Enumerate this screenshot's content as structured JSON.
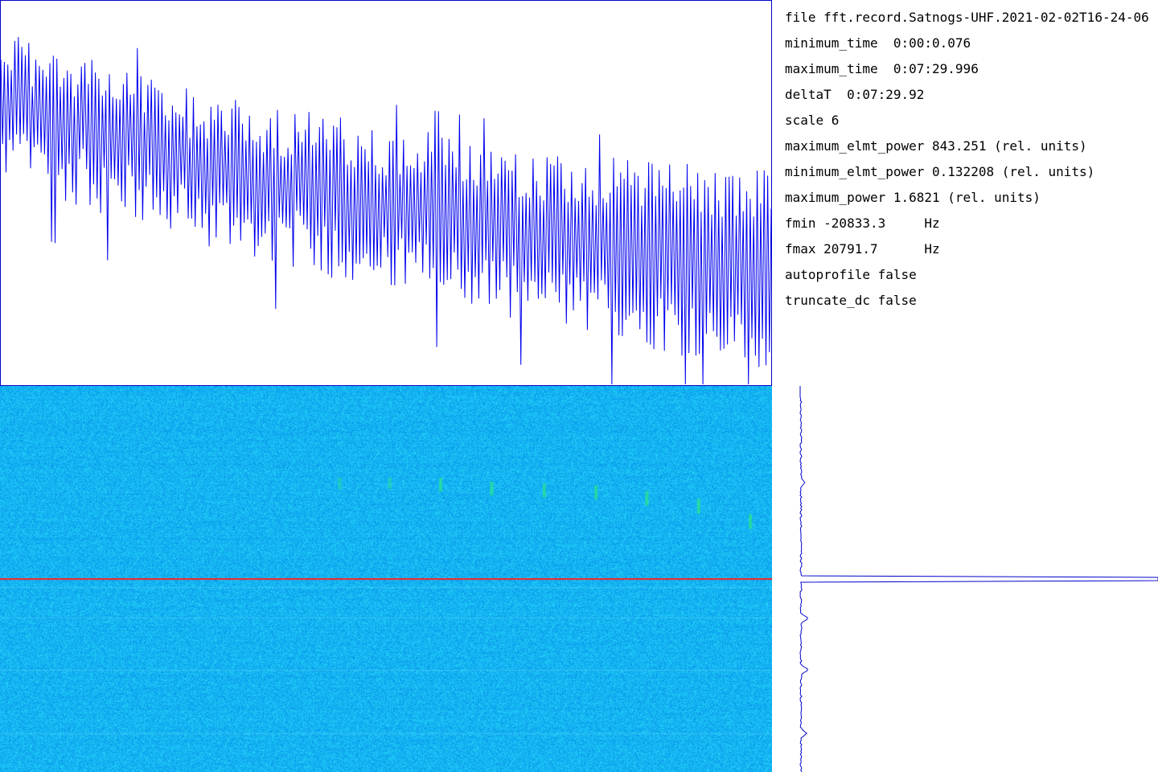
{
  "info_lines": [
    "file fft.record.Satnogs-UHF.2021-02-02T16-24-06",
    "minimum_time  0:00:0.076",
    "maximum_time  0:07:29.996",
    "deltaT  0:07:29.92",
    "scale 6",
    "maximum_elmt_power 843.251 (rel. units)",
    "minimum_elmt_power 0.132208 (rel. units)",
    "maximum_power 1.6821 (rel. units)",
    "fmin -20833.3     Hz",
    "fmax 20791.7      Hz",
    "autoprofile false",
    "truncate_dc false"
  ],
  "colors": {
    "trace": "#0000ee",
    "frame": "#0000cc",
    "marker": "#ff2020",
    "waterfall_base": "#15b4f2",
    "waterfall_dark": "#1e8fe0",
    "waterfall_light": "#3fd3f7",
    "waterfall_signal": "#28e0a0"
  },
  "chart_data": [
    {
      "type": "line",
      "description_role": "power vs time",
      "x_range": [
        0.076,
        449.996
      ],
      "trend": [
        {
          "t": 0.0,
          "peak": 0.97,
          "trough": 0.55
        },
        {
          "t": 0.25,
          "peak": 0.8,
          "trough": 0.38
        },
        {
          "t": 0.5,
          "peak": 0.7,
          "trough": 0.25
        },
        {
          "t": 0.75,
          "peak": 0.62,
          "trough": 0.14
        },
        {
          "t": 1.0,
          "peak": 0.58,
          "trough": 0.02
        }
      ],
      "oscillations": 220
    },
    {
      "type": "heatmap",
      "description_role": "spectrogram",
      "marker_fraction": 0.5,
      "signal_bursts": [
        {
          "x": 0.44,
          "y": 0.25,
          "strength": 0.4
        },
        {
          "x": 0.505,
          "y": 0.25,
          "strength": 0.4
        },
        {
          "x": 0.571,
          "y": 0.25,
          "strength": 0.9
        },
        {
          "x": 0.637,
          "y": 0.26,
          "strength": 0.9
        },
        {
          "x": 0.705,
          "y": 0.265,
          "strength": 0.9
        },
        {
          "x": 0.772,
          "y": 0.27,
          "strength": 0.9
        },
        {
          "x": 0.838,
          "y": 0.285,
          "strength": 1.0
        },
        {
          "x": 0.905,
          "y": 0.305,
          "strength": 1.0
        },
        {
          "x": 0.972,
          "y": 0.345,
          "strength": 1.0
        }
      ]
    },
    {
      "type": "line",
      "description_role": "frequency profile",
      "baseline": 0.075,
      "spikes": [
        {
          "y": 0.005,
          "value": 0.0
        },
        {
          "y": 0.25,
          "value": 0.085
        },
        {
          "y": 0.5,
          "value": 1.0
        },
        {
          "y": 0.602,
          "value": 0.095
        },
        {
          "y": 0.735,
          "value": 0.095
        },
        {
          "y": 0.9,
          "value": 0.09
        }
      ]
    }
  ]
}
